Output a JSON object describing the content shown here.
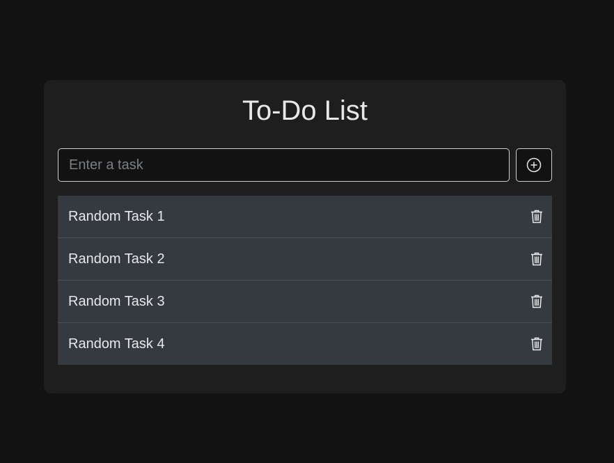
{
  "app": {
    "title": "To-Do List"
  },
  "input": {
    "placeholder": "Enter a task",
    "value": ""
  },
  "add_button": {
    "icon": "plus-circle-icon"
  },
  "tasks": [
    {
      "label": "Random Task 1",
      "delete_icon": "trash-icon"
    },
    {
      "label": "Random Task 2",
      "delete_icon": "trash-icon"
    },
    {
      "label": "Random Task 3",
      "delete_icon": "trash-icon"
    },
    {
      "label": "Random Task 4",
      "delete_icon": "trash-icon"
    }
  ],
  "colors": {
    "background": "#121212",
    "card": "#1e1e1e",
    "task_row": "#343a40",
    "text": "#e8e8e8",
    "border": "#d0d0d0"
  }
}
